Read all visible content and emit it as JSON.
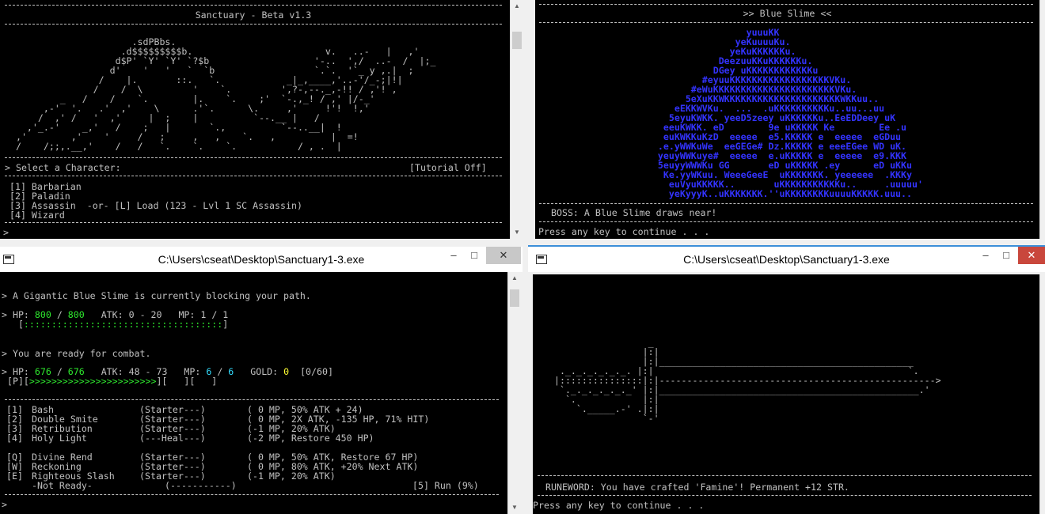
{
  "colors": {
    "green": "#2ee82e",
    "yellow": "#ffff33",
    "cyan": "#33ddff",
    "blue": "#3333ff",
    "console_text": "#c0c0c0"
  },
  "windows": {
    "top_left": {
      "screen_title": "Sanctuary - Beta v1.3",
      "art": [
        "                       .sdPBbs.",
        "                     .d$$$$$$$$$b.                        v.   ..-   |   ,'",
        "                    d$P' `Y' `Y' `?$b                   '-..  ',/  ..-  /  |;_",
        "                   d'    '   '   `  `b                  `.`.  '`_ y ,.|  ;",
        "                 /    |.       ::.   `.            _|_,____,'..-'/_-;|!|",
        "                /    /  \\         '    `.         ',?-,--._,-!! / ,'! ,",
        "          _   /    /    `.        |.    `.    ;'  `-.,_! / ,' |/-_'",
        "       ,-'  '.   .'  ,'    \\      .'`.      \\.     ,'     !'!  !,'",
        "      /  ,' /   '  ,'     |  ;    |          `--.__ |   /",
        "    ,'_.-'    _,'   /    ;   |       `.,          `--..__|  !",
        "  ,'        ,'    '     /   ;     ,   ,    `.   ,          |  =!",
        "  /    /;;,.__,'    /   /   `.    `.    `.           / , .  |"
      ],
      "select_label": "> Select a Character:",
      "tutorial_label": "[Tutorial Off]",
      "menu": [
        "[1] Barbarian",
        "[2] Paladin",
        "[3] Assassin  -or- [L] Load (123 - Lvl 1 SC Assassin)",
        "[4] Wizard"
      ],
      "prompt": ">"
    },
    "top_right": {
      "screen_title": ">> Blue Slime <<",
      "slime_art": [
        "                    yuuuKK",
        "                  yeKuuuuKu.",
        "                 yeKuKKKKKKu.",
        "               DeezuuKKuKKKKKKu.",
        "              DGey uKKKKKKKKKKKKu",
        "            #eyuuKKKKKKKKKKKKKKKKKKVKu.",
        "          #eWuKKKKKKKKKKKKKKKKKKKKKKVKu.",
        "         5eXuKKWKKKKKKKKKKKKKKKKKKKKKWKKuu..",
        "       eEKKWVKu.  ...  .uKKKKKKKKKKu..uu...uu",
        "      5eyuKWKK. yeeD5zeey uKKKKKKu..EeEDDeey uK",
        "     eeuKWKK. eD        9e uKKKKK Ke        Ee .u",
        "     euKWKKuKzD  eeeee  e5.KKKKK e  eeeee  eGDuu",
        "    .e.yWWKuWe  eeGEGe# Dz.KKKKK e eeeEGee WD uK.",
        "    yeuyWWKuye#  eeeee  e.uKKKKK e  eeeee  e9.KKK",
        "    5euyyWWWKu GG       eD uKKKKK .ey      eD uKKu",
        "     Ke.yyWKuu. WeeeGeeE  uKKKKKKK. yeeeeee  .KKKy",
        "      euVyuKKKKK..       uKKKKKKKKKKKu..     .uuuuu'",
        "      yeKyyyK..uKKKKKKK.''uKKKKKKKKuuuuKKKKK.uuu.."
      ],
      "boss_message": "BOSS: A Blue Slime draws near!",
      "continue_prompt": "Press any key to continue . . ."
    },
    "bottom_left": {
      "window_title": "C:\\Users\\cseat\\Desktop\\Sanctuary1-3.exe",
      "enemy_message": "> A Gigantic Blue Slime is currently blocking your path.",
      "enemy_stats": {
        "hp_label": "> HP:",
        "hp_current": "800",
        "hp_sep": "/",
        "hp_max": "800",
        "atk": "ATK: 0 - 20",
        "mp": "MP: 1 / 1",
        "bar_open": "   [",
        "bar_fill": "::::::::::::::::::::::::::::::::::::",
        "bar_close": "]"
      },
      "ready_message": "> You are ready for combat.",
      "player_stats": {
        "hp_label": "> HP:",
        "hp_current": "676",
        "hp_sep": "/",
        "hp_max": "676",
        "atk": "ATK: 48 - 73",
        "mp_label": "MP:",
        "mp_current": "6",
        "mp_sep": "/",
        "mp_max": "6",
        "gold_label": "GOLD:",
        "gold": "0",
        "progress": "[0/60]",
        "bar_prefix": " [P][",
        "bar_fill": ">>>>>>>>>>>>>>>>>>>>>>>",
        "bar_suffix": "][   ][   ]"
      },
      "skills": [
        {
          "key": "[1]",
          "name": "Bash",
          "tag": "(Starter---)",
          "desc": "( 0 MP, 50% ATK + 24)"
        },
        {
          "key": "[2]",
          "name": "Double Smite",
          "tag": "(Starter---)",
          "desc": "( 0 MP, 2X ATK, -135 HP, 71% HIT)"
        },
        {
          "key": "[3]",
          "name": "Retribution",
          "tag": "(Starter---)",
          "desc": "(-1 MP, 20% ATK)"
        },
        {
          "key": "[4]",
          "name": "Holy Light",
          "tag": "(---Heal---)",
          "desc": "(-2 MP, Restore 450 HP)"
        },
        {
          "key": "[Q]",
          "name": "Divine Rend",
          "tag": "(Starter---)",
          "desc": "( 0 MP, 50% ATK, Restore 67 HP)"
        },
        {
          "key": "[W]",
          "name": "Reckoning",
          "tag": "(Starter---)",
          "desc": "( 0 MP, 80% ATK, +20% Next ATK)"
        },
        {
          "key": "[E]",
          "name": "Righteous Slash",
          "tag": "(Starter---)",
          "desc": "(-1 MP, 20% ATK)"
        }
      ],
      "not_ready": "-Not Ready-",
      "not_ready_tag": "(-----------)",
      "run_option": "[5] Run (9%)",
      "prompt": ">"
    },
    "bottom_right": {
      "window_title": "C:\\Users\\cseat\\Desktop\\Sanctuary1-3.exe",
      "sword_art": [
        "                  _",
        "                 |:|",
        "                 |:|______________________________________________",
        "  ._._._._._._. |:|                                              `.",
        " |:::::::::::::::|:|-------------------------------------------------->",
        "  `._._._._._._' |:|_______________________________________________.'",
        "   `.            |:|",
        "     `._____.-' .|:|",
        "                 `-'"
      ],
      "runeword_message": "RUNEWORD: You have crafted 'Famine'! Permanent +12 STR.",
      "continue_prompt": "Press any key to continue . . ."
    }
  }
}
